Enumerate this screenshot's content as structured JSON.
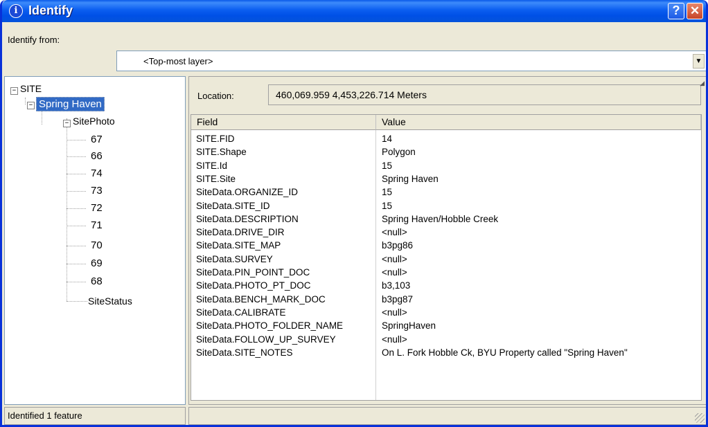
{
  "window": {
    "title": "Identify",
    "help_glyph": "?",
    "close_glyph": "✕",
    "icon": "info-icon"
  },
  "identify_from": {
    "label": "Identify from:",
    "value": "<Top-most layer>"
  },
  "tree": {
    "root": "SITE",
    "feature": "Spring Haven",
    "group": "SitePhoto",
    "photos": [
      "67",
      "66",
      "74",
      "73",
      "72",
      "71",
      "70",
      "69",
      "68"
    ],
    "status": "SiteStatus"
  },
  "location": {
    "label": "Location:",
    "value": "460,069.959  4,453,226.714 Meters"
  },
  "table": {
    "headers": {
      "field": "Field",
      "value": "Value"
    },
    "rows": [
      {
        "field": "SITE.FID",
        "value": "14"
      },
      {
        "field": "SITE.Shape",
        "value": "Polygon"
      },
      {
        "field": "SITE.Id",
        "value": "15"
      },
      {
        "field": "SITE.Site",
        "value": "Spring Haven"
      },
      {
        "field": "SiteData.ORGANIZE_ID",
        "value": "15"
      },
      {
        "field": "SiteData.SITE_ID",
        "value": "15"
      },
      {
        "field": "SiteData.DESCRIPTION",
        "value": "Spring Haven/Hobble Creek"
      },
      {
        "field": "SiteData.DRIVE_DIR",
        "value": "<null>"
      },
      {
        "field": "SiteData.SITE_MAP",
        "value": "b3pg86"
      },
      {
        "field": "SiteData.SURVEY",
        "value": "<null>"
      },
      {
        "field": "SiteData.PIN_POINT_DOC",
        "value": "<null>"
      },
      {
        "field": "SiteData.PHOTO_PT_DOC",
        "value": "b3,103"
      },
      {
        "field": "SiteData.BENCH_MARK_DOC",
        "value": "b3pg87"
      },
      {
        "field": "SiteData.CALIBRATE",
        "value": "<null>"
      },
      {
        "field": "SiteData.PHOTO_FOLDER_NAME",
        "value": "SpringHaven"
      },
      {
        "field": "SiteData.FOLLOW_UP_SURVEY",
        "value": "<null>"
      },
      {
        "field": "SiteData.SITE_NOTES",
        "value": "On L. Fork Hobble Ck, BYU Property called \"Spring Haven\""
      }
    ]
  },
  "status": {
    "text": "Identified 1 feature"
  },
  "colors": {
    "titlebar": "#0a5ae8",
    "selection": "#316ac5",
    "window_bg": "#ece9d8"
  }
}
